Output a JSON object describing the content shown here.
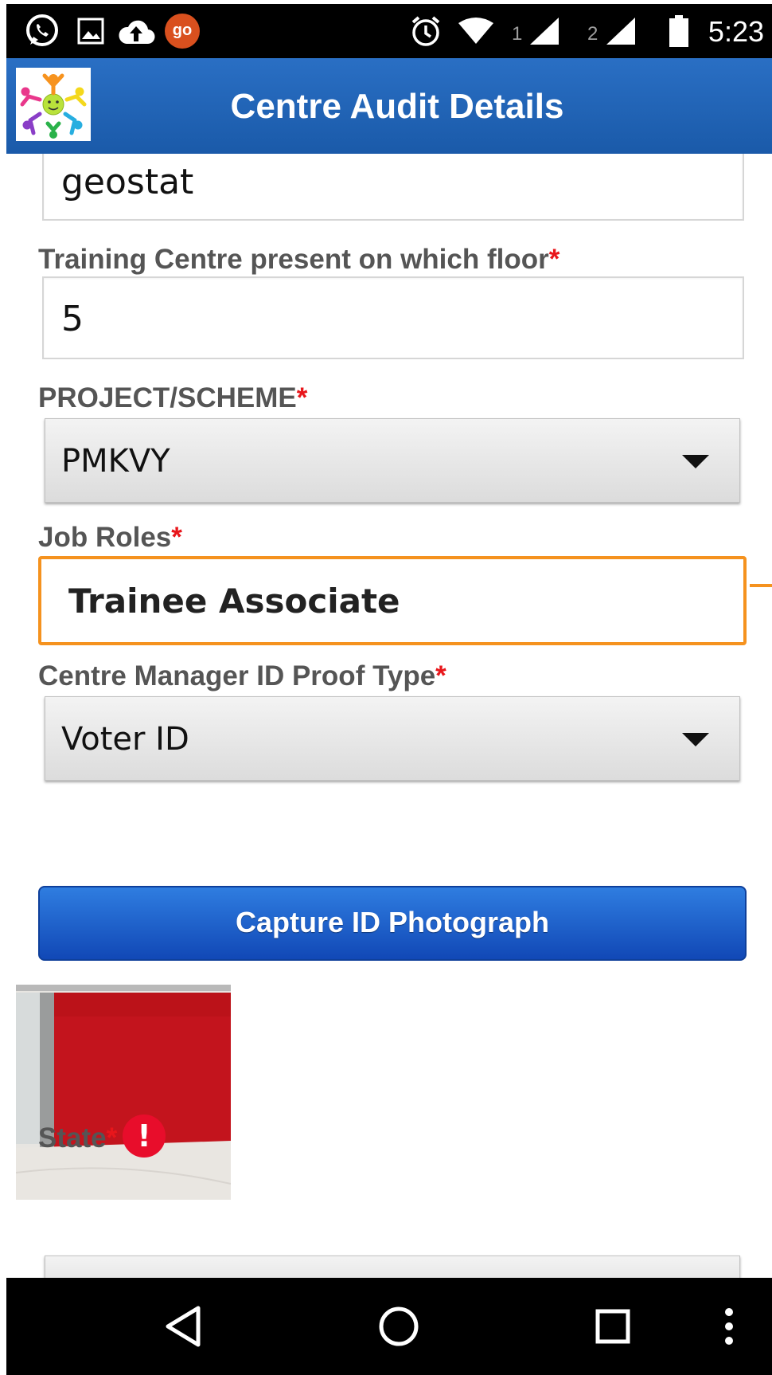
{
  "status_bar": {
    "time": "5:23",
    "sim1": "1",
    "sim2": "2",
    "notification_icons": [
      "whatsapp-icon",
      "gallery-icon",
      "cloud-upload-icon",
      "go-icon"
    ],
    "go_badge": "go",
    "system_icons": [
      "alarm-icon",
      "wifi-icon",
      "signal-icon",
      "signal-icon",
      "battery-icon"
    ]
  },
  "app_bar": {
    "title": "Centre Audit Details",
    "color": "#1f63b4"
  },
  "form": {
    "geostat_value": "geostat",
    "floor_label": "Training Centre present on which floor",
    "floor_value": "5",
    "project_label": "PROJECT/SCHEME",
    "project_value": "PMKVY",
    "job_roles_label": "Job Roles",
    "job_roles_value": "Trainee Associate",
    "id_proof_label": "Centre Manager ID Proof Type",
    "id_proof_value": "Voter ID",
    "capture_button": "Capture ID Photograph",
    "state_label": "State",
    "required_mark": "*",
    "error_mark": "!"
  },
  "colors": {
    "accent": "#f5921e",
    "required": "#e8161b",
    "button": "#1a5cc8"
  },
  "nav_bar": {
    "icons": [
      "back-icon",
      "home-icon",
      "recents-icon",
      "more-icon"
    ]
  }
}
